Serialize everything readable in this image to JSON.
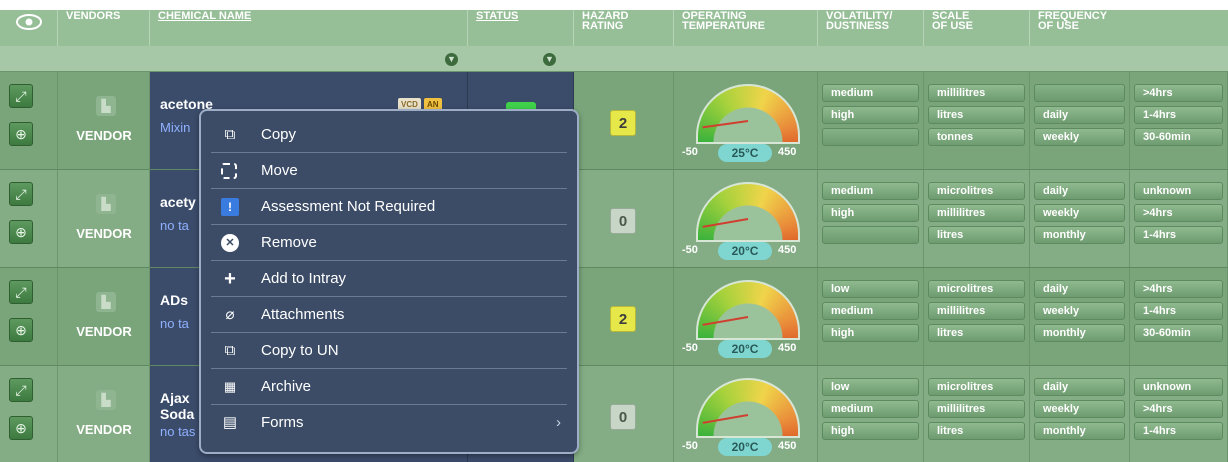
{
  "header": {
    "eye_icon": "eye-icon",
    "columns": {
      "vendors": "VENDORS",
      "chemical_name": "CHEMICAL NAME",
      "status": "STATUS",
      "hazard_1": "HAZARD",
      "hazard_2": "RATING",
      "temp_1": "OPERATING",
      "temp_2": "TEMPERATURE",
      "vol_1": "VOLATILITY/",
      "vol_2": "DUSTINESS",
      "scale_1": "SCALE",
      "scale_2": "OF USE",
      "freq_1": "FREQUENCY",
      "freq_2": "OF USE"
    }
  },
  "rows": [
    {
      "vendor": "VENDOR",
      "name": "acetone",
      "sub": "Mixin",
      "badges": [
        "VCD",
        "AN"
      ],
      "hazard": "2",
      "temp_min": "-50",
      "temp_max": "450",
      "temp_val": "25°C",
      "temp_fraction": 0.15,
      "volatility": [
        "medium",
        "high",
        ""
      ],
      "scale": [
        "millilitres",
        "litres",
        "tonnes"
      ],
      "frequency": [
        "",
        "daily",
        "weekly"
      ],
      "duration": [
        ">4hrs",
        "1-4hrs",
        "30-60min"
      ]
    },
    {
      "vendor": "VENDOR",
      "name": "acety",
      "sub": "no ta",
      "hazard": "0",
      "temp_min": "-50",
      "temp_max": "450",
      "temp_val": "20°C",
      "temp_fraction": 0.14,
      "volatility": [
        "medium",
        "high",
        ""
      ],
      "scale": [
        "microlitres",
        "millilitres",
        "litres"
      ],
      "frequency": [
        "daily",
        "weekly",
        "monthly"
      ],
      "duration": [
        "unknown",
        ">4hrs",
        "1-4hrs"
      ]
    },
    {
      "vendor": "VENDOR",
      "name": "ADs",
      "sub": "no ta",
      "hazard": "2",
      "temp_min": "-50",
      "temp_max": "450",
      "temp_val": "20°C",
      "temp_fraction": 0.14,
      "volatility": [
        "low",
        "medium",
        "high"
      ],
      "scale": [
        "microlitres",
        "millilitres",
        "litres"
      ],
      "frequency": [
        "daily",
        "weekly",
        "monthly"
      ],
      "duration": [
        ">4hrs",
        "1-4hrs",
        "30-60min"
      ]
    },
    {
      "vendor": "VENDOR",
      "name": "Ajax",
      "name2": "Soda",
      "sub": "no tas",
      "hazard": "0",
      "temp_min": "-50",
      "temp_max": "450",
      "temp_val": "20°C",
      "temp_fraction": 0.14,
      "volatility": [
        "low",
        "medium",
        "high"
      ],
      "scale": [
        "microlitres",
        "millilitres",
        "litres"
      ],
      "frequency": [
        "daily",
        "weekly",
        "monthly"
      ],
      "duration": [
        "unknown",
        ">4hrs",
        "1-4hrs"
      ]
    }
  ],
  "context_menu": {
    "items": [
      {
        "label": "Copy",
        "icon": "copy-icon"
      },
      {
        "label": "Move",
        "icon": "move-icon"
      },
      {
        "label": "Assessment Not Required",
        "icon": "exclamation-icon"
      },
      {
        "label": "Remove",
        "icon": "remove-icon"
      },
      {
        "label": "Add to Intray",
        "icon": "plus-icon"
      },
      {
        "label": "Attachments",
        "icon": "paperclip-icon"
      },
      {
        "label": "Copy to UN",
        "icon": "copy-icon"
      },
      {
        "label": "Archive",
        "icon": "archive-icon"
      },
      {
        "label": "Forms",
        "icon": "forms-icon",
        "has_submenu": true
      }
    ]
  },
  "colors": {
    "row_bg": "#7aa57b",
    "selected_bg": "#3b4c6a",
    "menu_bg": "#3c4c67",
    "hazard_yellow": "#e6e84a",
    "temp_badge": "#7fd6d1"
  }
}
